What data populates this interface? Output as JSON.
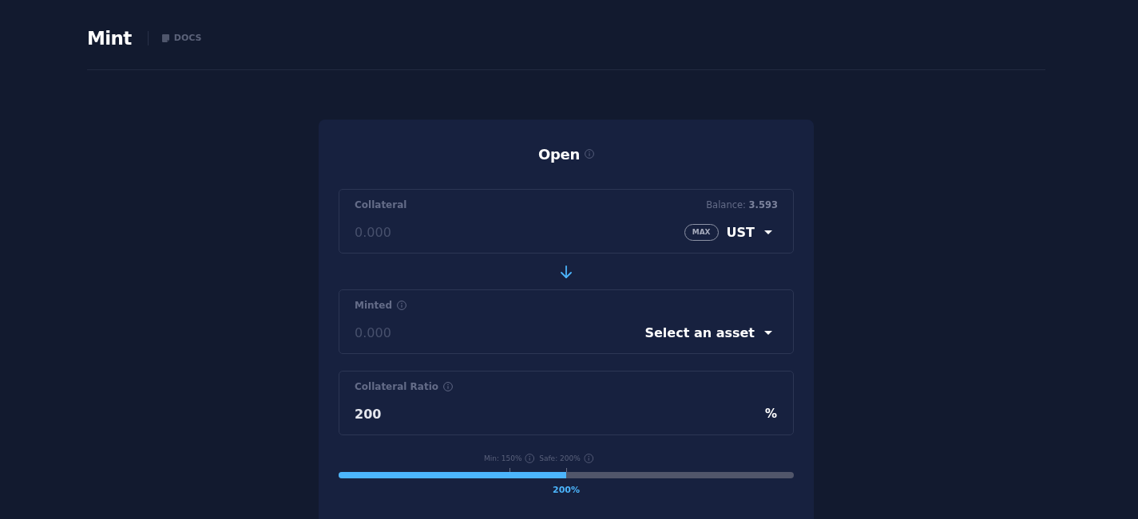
{
  "header": {
    "title": "Mint",
    "link": "DOCS"
  },
  "card": {
    "title": "Open",
    "info": true,
    "rows": [
      {
        "kind": "asset",
        "label": "Collateral",
        "info": false,
        "balance": "Balance: **3.593**",
        "placeholder": "0.000",
        "max": "MAX",
        "asset": "UST"
      },
      {
        "kind": "arrow"
      },
      {
        "kind": "asset",
        "label": "Minted",
        "info": true,
        "placeholder": "0.000",
        "asset": "Select an asset"
      },
      {
        "kind": "number",
        "label": "Collateral Ratio",
        "info": true,
        "value": "200",
        "unit": "%"
      }
    ],
    "ratio": {
      "level": 0.5,
      "reading": "200%",
      "markers": [
        {
          "label": "Min: 150%",
          "level": 0.375
        },
        {
          "label": "Safe: 200%",
          "level": 0.5
        }
      ]
    }
  }
}
